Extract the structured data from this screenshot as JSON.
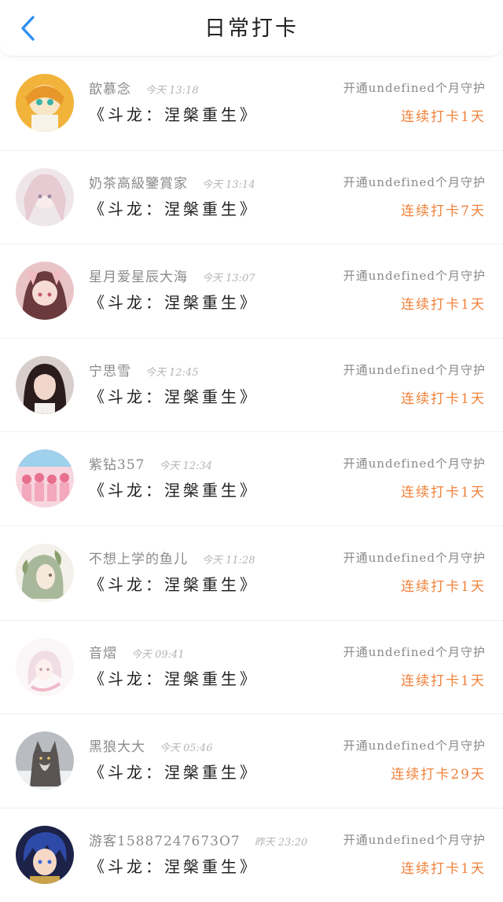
{
  "header": {
    "title": "日常打卡",
    "back_icon": "chevron-left-icon",
    "accent": "#2f8ff0"
  },
  "colors": {
    "streak": "#f0813a",
    "muted": "#8a8a8a"
  },
  "items": [
    {
      "nickname": "歆慕念",
      "time": "今天 13:18",
      "book": "《斗龙：涅槃重生》",
      "guard": "开通undefined个月守护",
      "streak": "连续打卡1天"
    },
    {
      "nickname": "奶茶高級鑒賞家",
      "time": "今天 13:14",
      "book": "《斗龙：涅槃重生》",
      "guard": "开通undefined个月守护",
      "streak": "连续打卡7天"
    },
    {
      "nickname": "星月爱星辰大海",
      "time": "今天 13:07",
      "book": "《斗龙：涅槃重生》",
      "guard": "开通undefined个月守护",
      "streak": "连续打卡1天"
    },
    {
      "nickname": "宁思雪",
      "time": "今天 12:45",
      "book": "《斗龙：涅槃重生》",
      "guard": "开通undefined个月守护",
      "streak": "连续打卡1天"
    },
    {
      "nickname": "紫钻357",
      "time": "今天 12:34",
      "book": "《斗龙：涅槃重生》",
      "guard": "开通undefined个月守护",
      "streak": "连续打卡1天"
    },
    {
      "nickname": "不想上学的鱼儿",
      "time": "今天 11:28",
      "book": "《斗龙：涅槃重生》",
      "guard": "开通undefined个月守护",
      "streak": "连续打卡1天"
    },
    {
      "nickname": "音熠",
      "time": "今天 09:41",
      "book": "《斗龙：涅槃重生》",
      "guard": "开通undefined个月守护",
      "streak": "连续打卡1天"
    },
    {
      "nickname": "黑狼大大",
      "time": "今天 05:46",
      "book": "《斗龙：涅槃重生》",
      "guard": "开通undefined个月守护",
      "streak": "连续打卡29天"
    },
    {
      "nickname": "游客15887247673O7",
      "time": "昨天 23:20",
      "book": "《斗龙：涅槃重生》",
      "guard": "开通undefined个月守护",
      "streak": "连续打卡1天"
    }
  ]
}
